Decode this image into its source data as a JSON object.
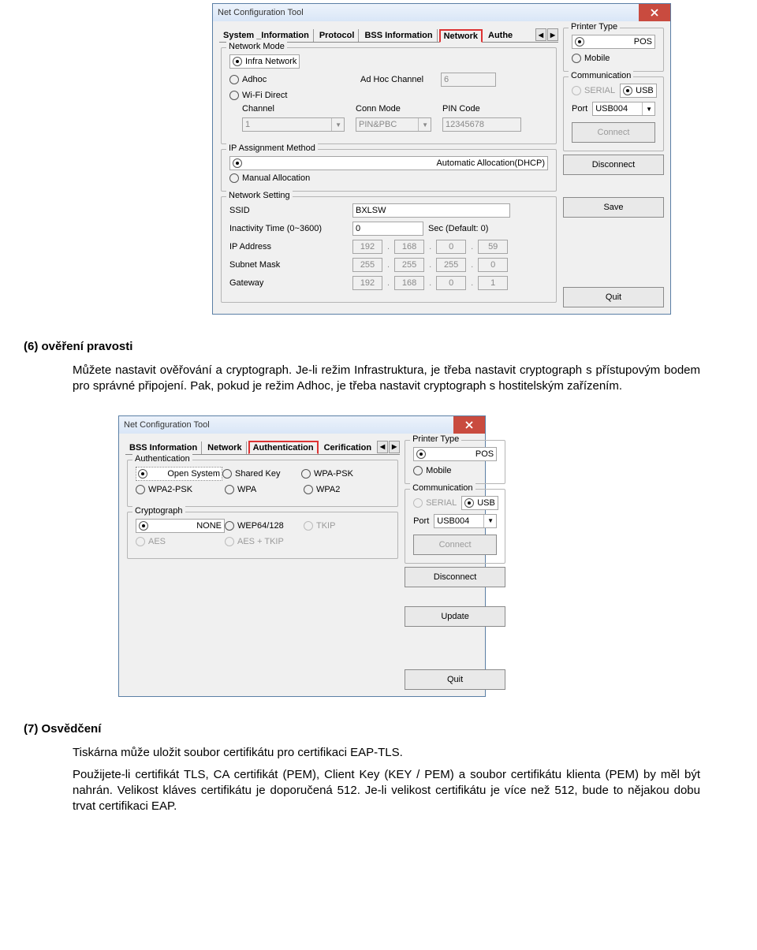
{
  "dialog1": {
    "title": "Net Configuration Tool",
    "tabs": {
      "t0": "System _Information",
      "t1": "Protocol",
      "t2": "BSS Information",
      "t3": "Network",
      "t4": "Authe"
    },
    "networkMode": {
      "legend": "Network Mode",
      "infra": "Infra Network",
      "adhoc": "Adhoc",
      "wifi": "Wi-Fi Direct",
      "adhocch": "Ad Hoc Channel",
      "adhocch_val": "6",
      "ch": "Channel",
      "ch_val": "1",
      "cm": "Conn Mode",
      "cm_val": "PIN&PBC",
      "pin": "PIN Code",
      "pin_val": "12345678"
    },
    "ip": {
      "legend": "IP Assignment Method",
      "auto": "Automatic Allocation(DHCP)",
      "manual": "Manual Allocation"
    },
    "ns": {
      "legend": "Network Setting",
      "ssid": "SSID",
      "ssid_val": "BXLSW",
      "inact": "Inactivity Time (0~3600)",
      "inact_val": "0",
      "inact_sfx": "Sec (Default: 0)",
      "ipaddr": "IP Address",
      "ip1": "192",
      "ip2": "168",
      "ip3": "0",
      "ip4": "59",
      "sub": "Subnet Mask",
      "s1": "255",
      "s2": "255",
      "s3": "255",
      "s4": "0",
      "gw": "Gateway",
      "g1": "192",
      "g2": "168",
      "g3": "0",
      "g4": "1"
    },
    "ptype": {
      "legend": "Printer Type",
      "pos": "POS",
      "mobile": "Mobile"
    },
    "comm": {
      "legend": "Communication",
      "serial": "SERIAL",
      "usb": "USB",
      "port": "Port",
      "port_val": "USB004"
    },
    "btn": {
      "connect": "Connect",
      "disconnect": "Disconnect",
      "save": "Save",
      "quit": "Quit"
    }
  },
  "doc": {
    "h6": "(6) ověření pravosti",
    "p6a": "Můžete nastavit ověřování a cryptograph. Je-li režim Infrastruktura, je třeba nastavit cryptograph s přístupovým bodem pro správné připojení. Pak, pokud je režim Adhoc, je třeba nastavit cryptograph s hostitelským zařízením.",
    "h7": "(7) Osvědčení",
    "p7a": "Tiskárna může uložit soubor certifikátu pro certifikaci EAP-TLS.",
    "p7b": "Použijete-li certifikát TLS, CA certifikát (PEM), Client Key (KEY / PEM) a soubor certifikátu klienta (PEM) by měl být nahrán. Velikost kláves certifikátu je doporučená 512. Je-li velikost certifikátu je více než 512, bude to nějakou dobu trvat certifikaci EAP."
  },
  "dialog2": {
    "title": "Net Configuration Tool",
    "tabs": {
      "t0": "BSS Information",
      "t1": "Network",
      "t2": "Authentication",
      "t3": "Cerification"
    },
    "auth": {
      "legend": "Authentication",
      "open": "Open System",
      "sk": "Shared Key",
      "wpapsk": "WPA-PSK",
      "wpa2psk": "WPA2-PSK",
      "wpa": "WPA",
      "wpa2": "WPA2"
    },
    "cry": {
      "legend": "Cryptograph",
      "none": "NONE",
      "wep": "WEP64/128",
      "tkip": "TKIP",
      "aes": "AES",
      "aestkip": "AES + TKIP"
    },
    "ptype": {
      "legend": "Printer Type",
      "pos": "POS",
      "mobile": "Mobile"
    },
    "comm": {
      "legend": "Communication",
      "serial": "SERIAL",
      "usb": "USB",
      "port": "Port",
      "port_val": "USB004"
    },
    "btn": {
      "connect": "Connect",
      "disconnect": "Disconnect",
      "update": "Update",
      "quit": "Quit"
    }
  }
}
